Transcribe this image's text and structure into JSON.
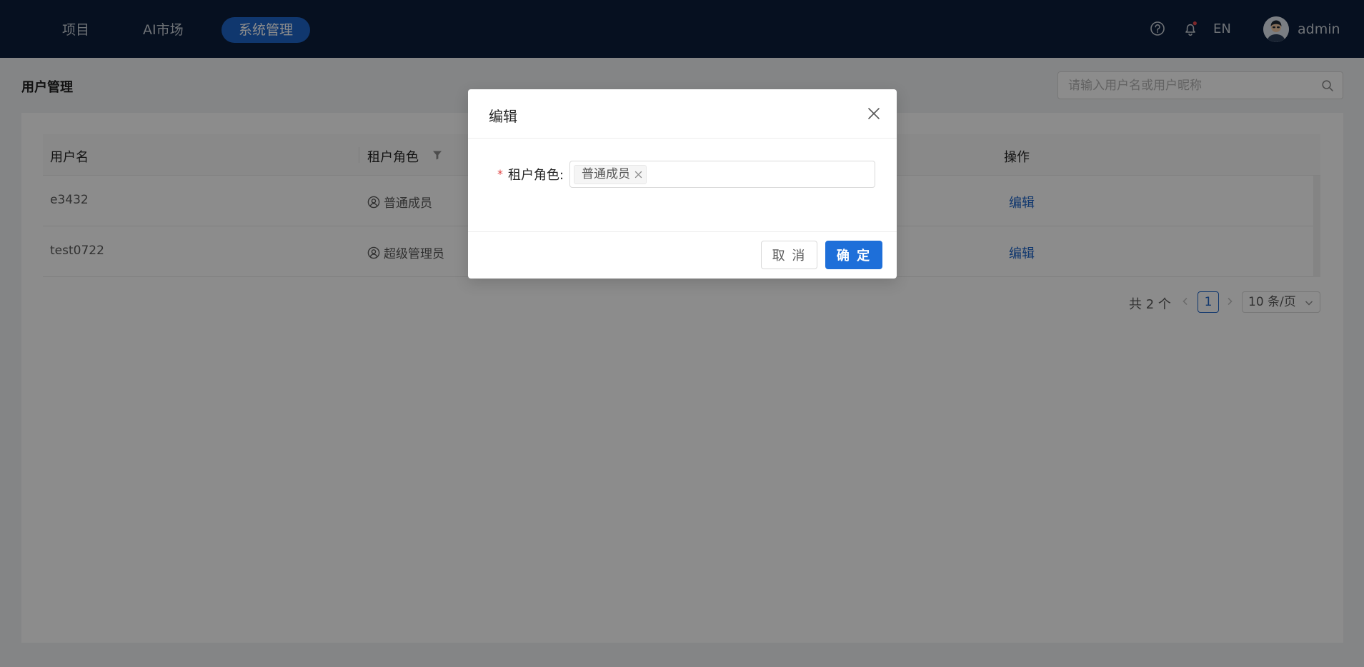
{
  "nav": {
    "items": [
      {
        "label": "项目"
      },
      {
        "label": "AI市场"
      },
      {
        "label": "系统管理",
        "active": true
      }
    ],
    "help_icon": "question-circle-icon",
    "bell_icon": "bell-icon",
    "language": "EN",
    "username": "admin"
  },
  "page": {
    "title": "用户管理",
    "search_placeholder": "请输入用户名或用户昵称"
  },
  "table": {
    "columns": [
      "用户名",
      "租户角色",
      "操作"
    ],
    "rows": [
      {
        "username": "e3432",
        "role": "普通成员",
        "action": "编辑"
      },
      {
        "username": "test0722",
        "role": "超级管理员",
        "action": "编辑"
      }
    ]
  },
  "pagination": {
    "total": "共 2 个",
    "current_page": "1",
    "page_size": "10 条/页"
  },
  "modal": {
    "title": "编辑",
    "field_label": "租户角色:",
    "selected_tag": "普通成员",
    "cancel_label": "取 消",
    "ok_label": "确 定"
  },
  "colors": {
    "nav_bg": "#0c1e3b",
    "accent": "#1e64c8",
    "primary_button": "#1e6fd9",
    "notification_dot": "#e5484d"
  }
}
